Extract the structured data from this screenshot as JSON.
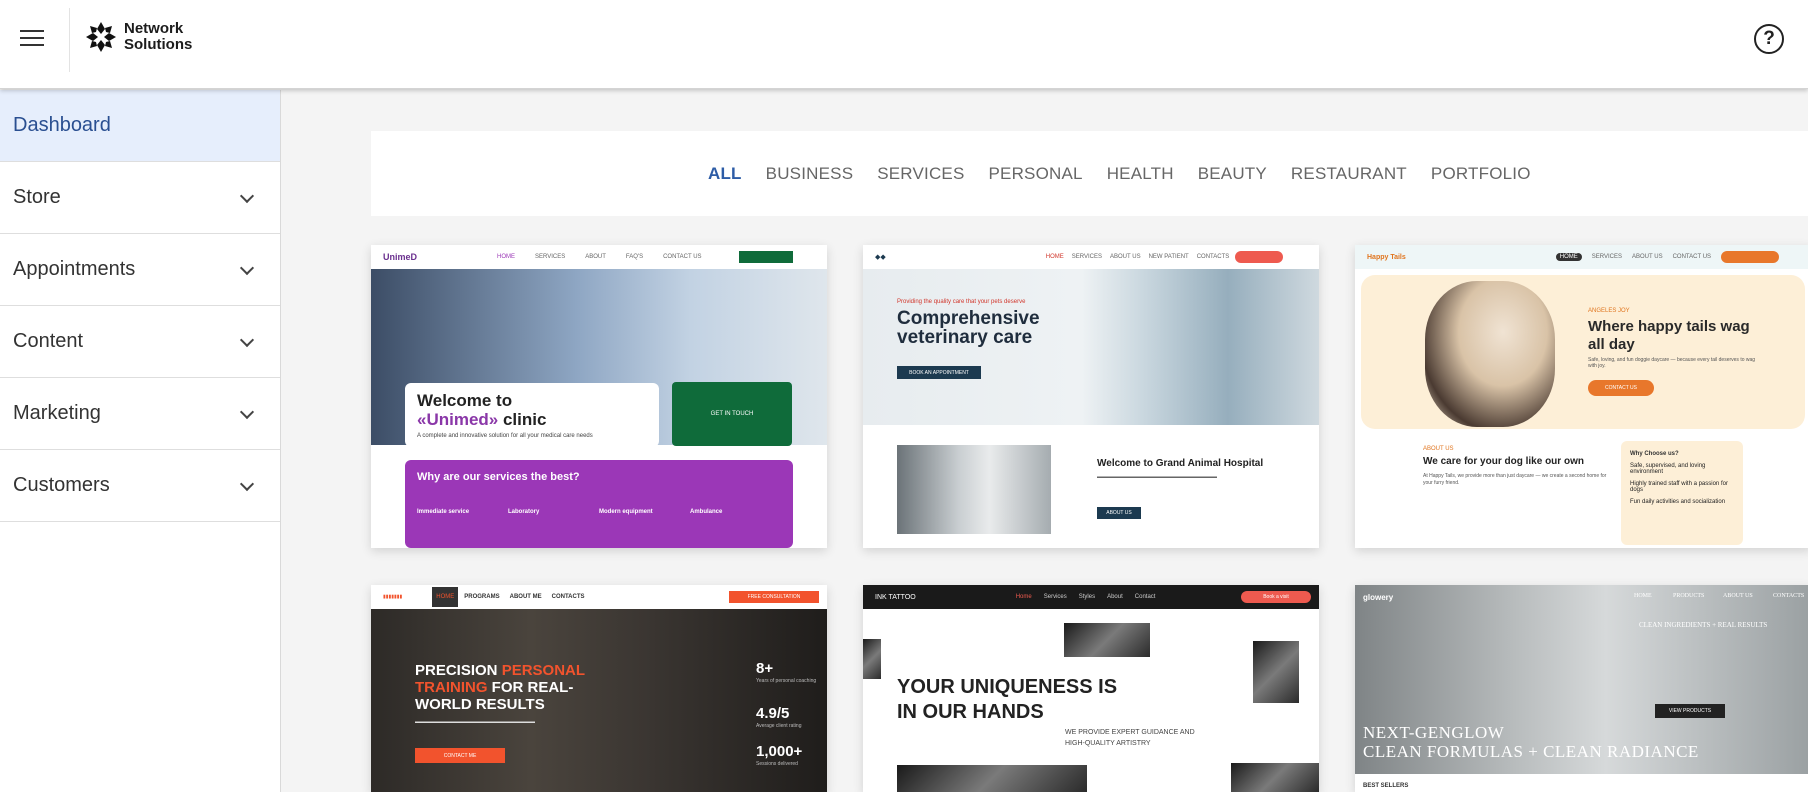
{
  "header": {
    "brand": "Network\nSolutions",
    "help_icon": "question-circle-icon"
  },
  "sidebar": {
    "items": [
      {
        "label": "Dashboard",
        "active": true
      },
      {
        "label": "Store"
      },
      {
        "label": "Appointments"
      },
      {
        "label": "Content"
      },
      {
        "label": "Marketing"
      },
      {
        "label": "Customers"
      }
    ]
  },
  "filters": [
    "ALL",
    "BUSINESS",
    "SERVICES",
    "PERSONAL",
    "HEALTH",
    "BEAUTY",
    "RESTAURANT",
    "PORTFOLIO"
  ],
  "templates": {
    "unimed": {
      "logo": "UnimeD",
      "nav": [
        "HOME",
        "SERVICES",
        "ABOUT",
        "FAQ'S",
        "CONTACT US"
      ],
      "headline_1": "Welcome to",
      "headline_brand": "«Unimed»",
      "headline_2": " clinic",
      "subtitle": "A complete and innovative solution for all your medical care needs",
      "cta": "GET IN TOUCH",
      "services_title": "Why are our services the best?",
      "services": [
        "Immediate service",
        "Laboratory",
        "Modern equipment",
        "Ambulance"
      ]
    },
    "vet": {
      "nav": [
        "HOME",
        "SERVICES",
        "ABOUT US",
        "NEW PATIENT",
        "CONTACTS"
      ],
      "kicker": "Providing the quality care that your pets deserve",
      "headline": "Comprehensive veterinary care",
      "cta": "BOOK AN APPOINTMENT",
      "sub": "Welcome to Grand Animal Hospital",
      "cta2": "ABOUT US"
    },
    "tails": {
      "nav": [
        "HOME",
        "SERVICES",
        "ABOUT US",
        "CONTACT US"
      ],
      "kicker": "ANGELES JOY",
      "headline": "Where happy tails wag all day",
      "para": "Safe, loving, and fun doggie daycare — because every tail deserves to wag with joy.",
      "cta": "CONTACT US",
      "about": "ABOUT US",
      "about_title": "We care for your dog like our own",
      "about_para": "At Happy Tails, we provide more than just daycare — we create a second home for your furry friend.",
      "why_title": "Why Choose us?",
      "why_items": [
        "Safe, supervised, and loving environment",
        "Highly trained staff with a passion for dogs",
        "Fun daily activities and socialization"
      ]
    },
    "fitness": {
      "nav": [
        "HOME",
        "PROGRAMS",
        "ABOUT ME",
        "CONTACTS"
      ],
      "cta_top": "FREE CONSULTATION",
      "headline_1": "PRECISION ",
      "headline_accent": "PERSONAL TRAINING",
      "headline_2": " FOR REAL-WORLD RESULTS",
      "cta": "CONTACT ME",
      "stats": [
        {
          "value": "8+",
          "label": "Years of personal coaching"
        },
        {
          "value": "4.9/5",
          "label": "Average client rating"
        },
        {
          "value": "1,000+",
          "label": "Sessions delivered"
        }
      ]
    },
    "tattoo": {
      "logo": "INK TATTOO",
      "nav": [
        "Home",
        "Services",
        "Styles",
        "About",
        "Contact"
      ],
      "cta": "Book a visit",
      "headline": "YOUR UNIQUENESS IS IN OUR HANDS",
      "sub": "WE PROVIDE EXPERT GUIDANCE AND HIGH-QUALITY ARTISTRY"
    },
    "glowery": {
      "logo": "glowery",
      "nav": [
        "HOME",
        "PRODUCTS",
        "ABOUT US",
        "CONTACTS"
      ],
      "right_title": "CLEAN INGREDIENTS + REAL RESULTS",
      "cta": "VIEW PRODUCTS",
      "headline": "NEXT-GENGLOW\nCLEAN FORMULAS + CLEAN RADIANCE",
      "best": "BEST SELLERS"
    }
  }
}
